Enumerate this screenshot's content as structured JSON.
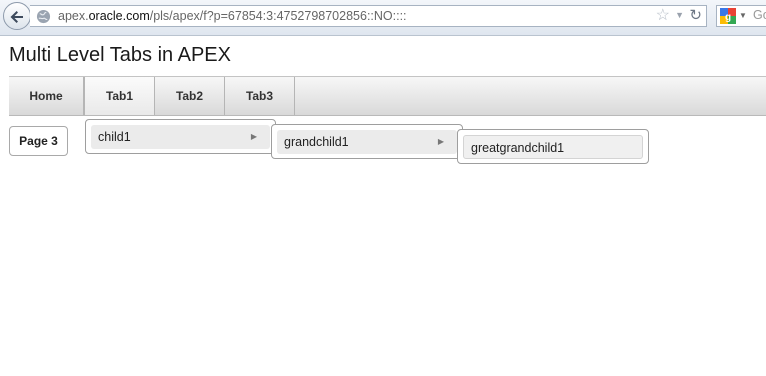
{
  "browser": {
    "url_domain_prefix": "apex.",
    "url_domain_bold": "oracle.com",
    "url_path": "/pls/apex/f?p=67854:3:4752798702856::NO::::",
    "search_text": "Go"
  },
  "page": {
    "title": "Multi Level Tabs in APEX"
  },
  "tabs": [
    {
      "label": "Home"
    },
    {
      "label": "Tab1"
    },
    {
      "label": "Tab2"
    },
    {
      "label": "Tab3"
    }
  ],
  "subtab": {
    "label": "Page 3"
  },
  "menus": {
    "level1": {
      "label": "child1"
    },
    "level2": {
      "label": "grandchild1"
    },
    "level3": {
      "label": "greatgrandchild1"
    }
  }
}
